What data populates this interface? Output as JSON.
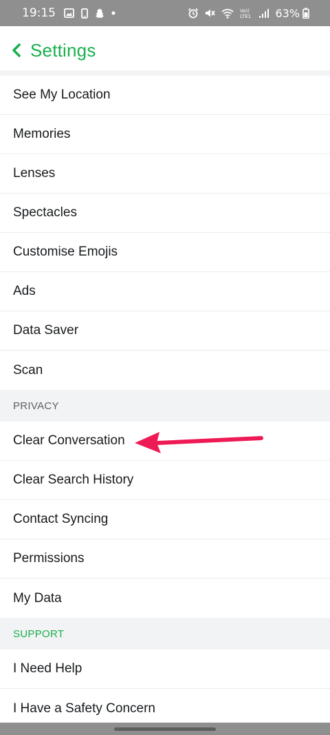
{
  "status_bar": {
    "time": "19:15",
    "battery_percent": "63%",
    "left_icons": [
      "image-icon",
      "phone-icon",
      "snapchat-ghost-icon",
      "dot-icon"
    ],
    "right_icons": [
      "alarm-icon",
      "mute-icon",
      "wifi-icon",
      "volte-icon",
      "signal-icon",
      "battery-icon"
    ],
    "volte_text": "Vo)) LTE1"
  },
  "header": {
    "back_icon": "chevron-left-icon",
    "title": "Settings",
    "accent_color": "#17b04c"
  },
  "list": {
    "items_top": [
      "See My Location",
      "Memories",
      "Lenses",
      "Spectacles",
      "Customise Emojis",
      "Ads",
      "Data Saver",
      "Scan"
    ],
    "privacy_header": "PRIVACY",
    "privacy_items": [
      "Clear Conversation",
      "Clear Search History",
      "Contact Syncing",
      "Permissions",
      "My Data"
    ],
    "support_header": "SUPPORT",
    "support_items": [
      "I Need Help",
      "I Have a Safety Concern"
    ]
  },
  "annotation": {
    "arrow_color": "#ee1a55",
    "points_to": "Clear Conversation"
  }
}
